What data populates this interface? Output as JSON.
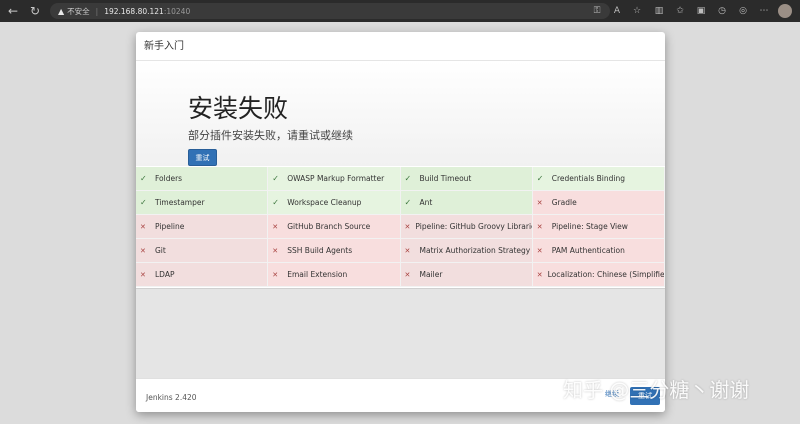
{
  "browser": {
    "security_label": "不安全",
    "url_host": "192.168.80.121",
    "url_port": ":10240"
  },
  "modal": {
    "header_title": "新手入门",
    "hero_title": "安装失败",
    "hero_subtitle": "部分插件安装失败，请重试或继续",
    "retry_label": "重试",
    "plugins": [
      [
        {
          "name": "Folders",
          "status": "success"
        },
        {
          "name": "OWASP Markup Formatter",
          "status": "success"
        },
        {
          "name": "Build Timeout",
          "status": "success"
        },
        {
          "name": "Credentials Binding",
          "status": "success"
        }
      ],
      [
        {
          "name": "Timestamper",
          "status": "success"
        },
        {
          "name": "Workspace Cleanup",
          "status": "success"
        },
        {
          "name": "Ant",
          "status": "success"
        },
        {
          "name": "Gradle",
          "status": "failure"
        }
      ],
      [
        {
          "name": "Pipeline",
          "status": "failure"
        },
        {
          "name": "GitHub Branch Source",
          "status": "failure"
        },
        {
          "name": "Pipeline: GitHub Groovy Libraries",
          "status": "failure"
        },
        {
          "name": "Pipeline: Stage View",
          "status": "failure"
        }
      ],
      [
        {
          "name": "Git",
          "status": "failure"
        },
        {
          "name": "SSH Build Agents",
          "status": "failure"
        },
        {
          "name": "Matrix Authorization Strategy",
          "status": "failure"
        },
        {
          "name": "PAM Authentication",
          "status": "failure"
        }
      ],
      [
        {
          "name": "LDAP",
          "status": "failure"
        },
        {
          "name": "Email Extension",
          "status": "failure"
        },
        {
          "name": "Mailer",
          "status": "failure"
        },
        {
          "name": "Localization: Chinese (Simplified)",
          "status": "failure"
        }
      ]
    ],
    "footer": {
      "version": "Jenkins 2.420",
      "continue_label": "继续",
      "retry_label": "重试"
    }
  },
  "watermark": "知乎 @三分糖丶谢谢",
  "colors": {
    "accent": "#3171b5",
    "success_bg": "#dff0d8",
    "failure_bg": "#f2dede"
  }
}
